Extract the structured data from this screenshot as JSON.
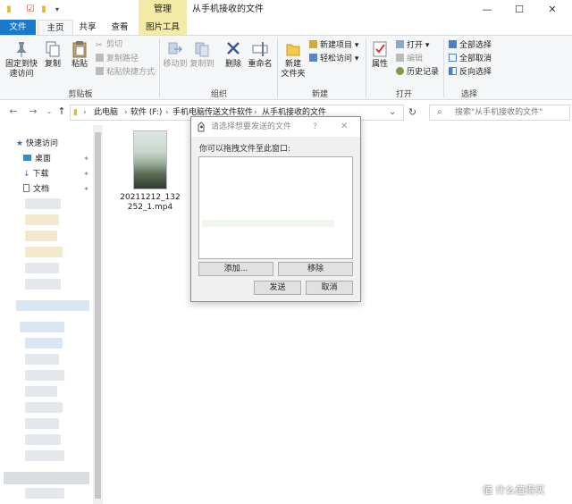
{
  "window": {
    "title": "从手机接收的文件",
    "context_tab_group": "管理",
    "controls": {
      "minimize": "—",
      "maximize": "☐",
      "close": "✕"
    }
  },
  "tabs": [
    {
      "label": "文件"
    },
    {
      "label": "主页"
    },
    {
      "label": "共享"
    },
    {
      "label": "查看"
    },
    {
      "label": "图片工具"
    }
  ],
  "ribbon": {
    "clipboard": {
      "pin": "固定到快速访问",
      "pin_line1": "固定到快",
      "pin_line2": "速访问",
      "copy": "复制",
      "paste": "粘贴",
      "cut": "剪切",
      "copy_path": "复制路径",
      "paste_shortcut": "粘贴快捷方式",
      "group": "剪贴板"
    },
    "organize": {
      "move_to": "移动到",
      "copy_to": "复制到",
      "delete": "删除",
      "rename": "重命名",
      "group": "组织"
    },
    "new": {
      "new_folder_line1": "新建",
      "new_folder_line2": "文件夹",
      "new_item": "新建项目",
      "easy_access": "轻松访问",
      "group": "新建"
    },
    "open": {
      "properties": "属性",
      "open": "打开",
      "edit": "编辑",
      "history": "历史记录",
      "group": "打开"
    },
    "select": {
      "select_all": "全部选择",
      "select_none": "全部取消",
      "invert": "反向选择",
      "group": "选择"
    }
  },
  "address": {
    "crumbs": [
      "此电脑",
      "软件 (F:)",
      "手机电脑传送文件软件",
      "从手机接收的文件"
    ],
    "search_placeholder": "搜索\"从手机接收的文件\""
  },
  "nav_pane": {
    "quick_access": "快速访问",
    "items": [
      "桌面",
      "下载",
      "文档"
    ]
  },
  "files": [
    {
      "name": "20211212_132252_1.mp4",
      "name_line1": "20211212_132",
      "name_line2": "252_1.mp4"
    }
  ],
  "dialog": {
    "title": "请选择想要发送的文件",
    "help": "?",
    "close": "✕",
    "hint": "你可以拖拽文件至此窗口:",
    "add": "添加...",
    "remove": "移除",
    "send": "发送",
    "cancel": "取消"
  },
  "watermark": "值 什么值得买",
  "colors": {
    "file_tab": "#1979ca",
    "context_tab": "#f3eaa6",
    "folder": "#f2c94c"
  }
}
